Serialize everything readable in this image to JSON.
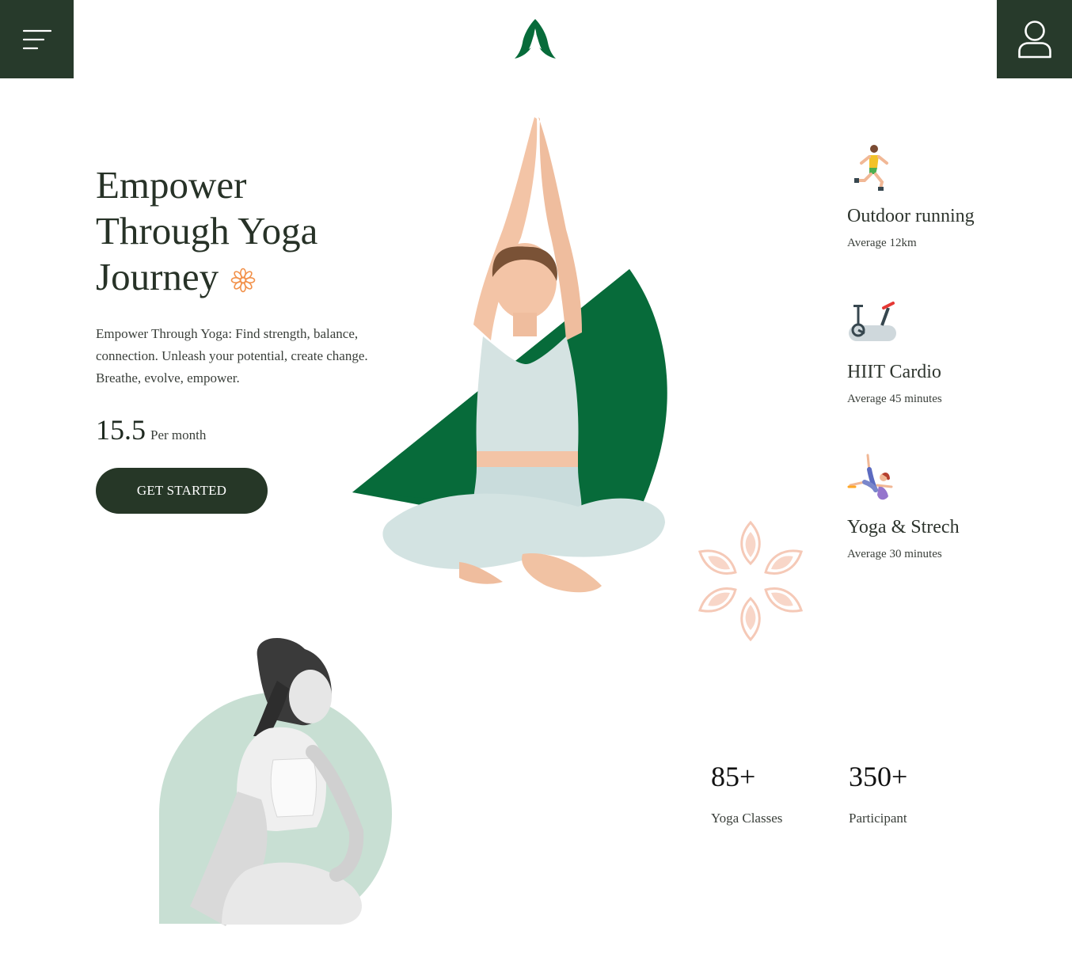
{
  "header": {
    "menu_icon": "hamburger-menu-icon",
    "logo_icon": "praying-hands-logo-icon",
    "user_icon": "user-profile-icon",
    "brand_color": "#273a2b",
    "logo_color": "#076b3a"
  },
  "hero": {
    "title": "Empower Through Yoga Journey",
    "title_icon": "orange-flower-icon",
    "description": "Empower Through Yoga: Find strength, balance, connection. Unleash your potential, create change. Breathe, evolve, empower.",
    "price_value": "15.5",
    "price_unit": "Per month",
    "cta_label": "GET STARTED",
    "accent_green": "#076b3a",
    "accent_orange": "#f2914a"
  },
  "activities": [
    {
      "icon": "running-person-icon",
      "title": "Outdoor running",
      "subtitle": "Average 12km"
    },
    {
      "icon": "exercise-bike-icon",
      "title": "HIIT Cardio",
      "subtitle": "Average 45 minutes"
    },
    {
      "icon": "yoga-stretch-icon",
      "title": "Yoga & Strech",
      "subtitle": "Average 30 minutes"
    }
  ],
  "decor": {
    "lotus_icon": "lotus-outline-icon",
    "lotus_color": "#f5c9b7",
    "arch_color": "#c8dfd3"
  },
  "stats": [
    {
      "value": "85+",
      "label": "Yoga Classes"
    },
    {
      "value": "350+",
      "label": "Participant"
    }
  ]
}
